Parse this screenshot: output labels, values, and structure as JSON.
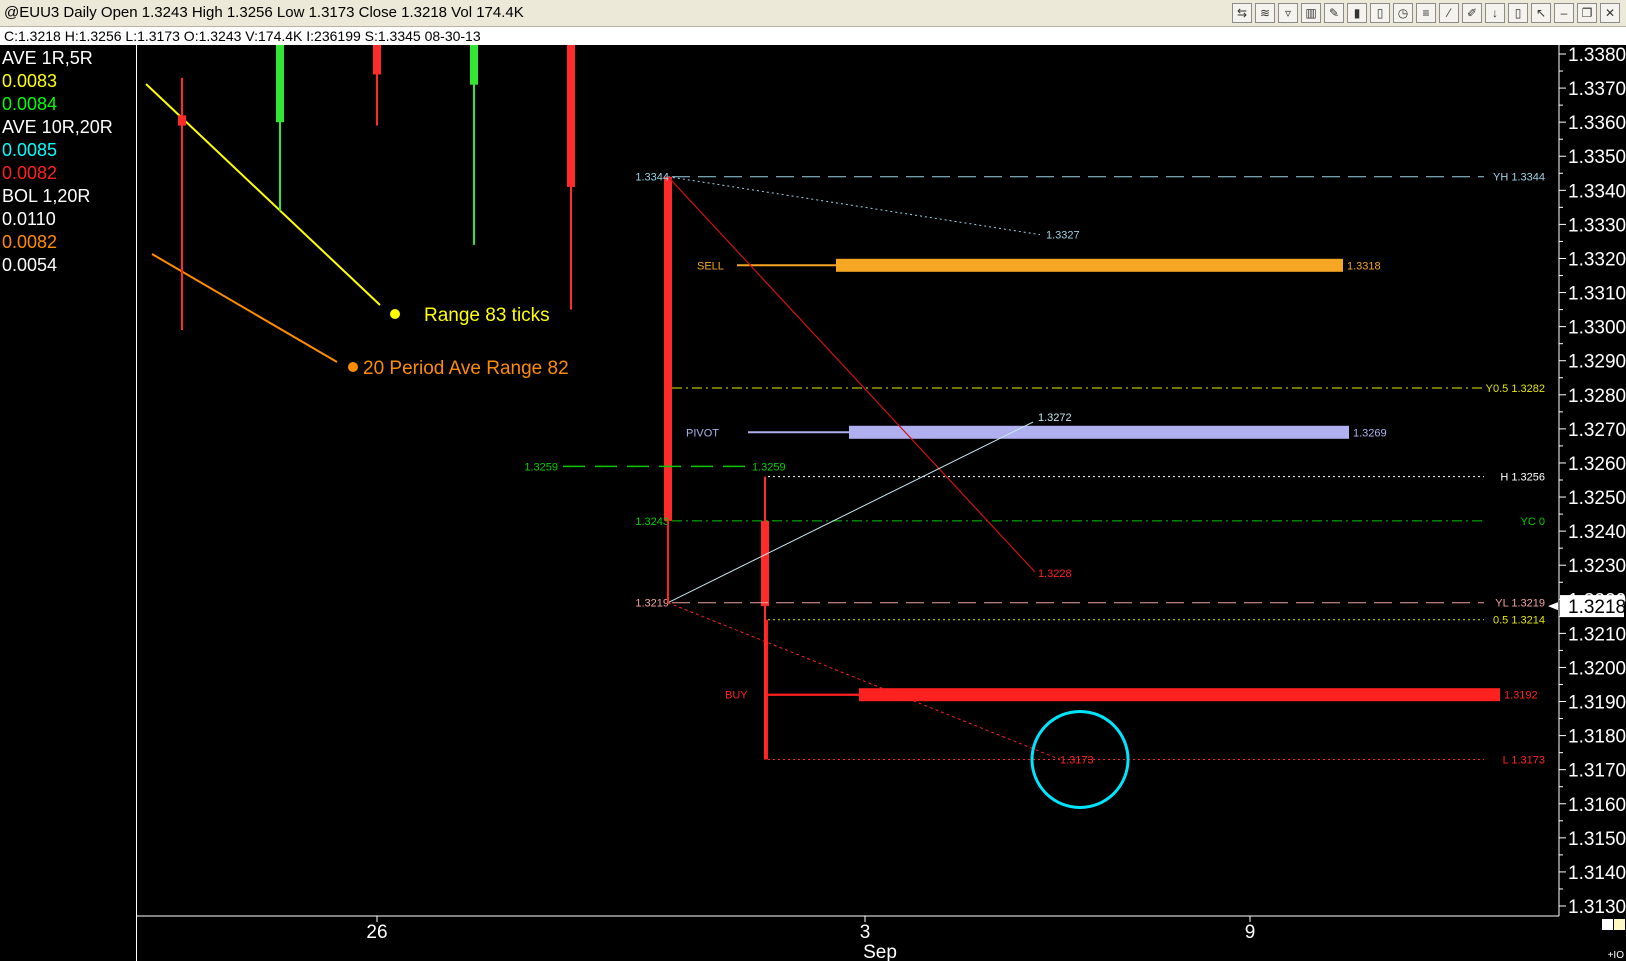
{
  "window": {
    "title": "@EUU3 Daily Open 1.3243 High 1.3256 Low 1.3173 Close 1.3218 Vol 174.4K",
    "info": "C:1.3218  H:1.3256  L:1.3173  O:1.3243  V:174.4K  I:236199  S:1.3345  08-30-13",
    "toolbar_icons": [
      "cursor-icon",
      "fibonacci-icon",
      "shapes-icon",
      "chart-icon",
      "pencil-icon",
      "bar-chart-icon",
      "candle-icon",
      "clock-icon",
      "checklist-icon",
      "trend-tool-icon",
      "pen-icon",
      "arrow-down-icon",
      "trash-icon",
      "pointer-icon",
      "minimize-icon",
      "restore-icon",
      "close-icon"
    ],
    "toolbar_glyphs": [
      "⇆",
      "≋",
      "▿",
      "▥",
      "✎",
      "▮",
      "▯",
      "◷",
      "≡",
      "⁄",
      "✐",
      "↓",
      "▯",
      "↖",
      "–",
      "❐",
      "✕"
    ]
  },
  "indicators": [
    {
      "text": "AVE  1R,5R",
      "color": "#ffffff"
    },
    {
      "text": "0.0083",
      "color": "#ffff00"
    },
    {
      "text": "0.0084",
      "color": "#00ff00"
    },
    {
      "text": "AVE  10R,20R",
      "color": "#ffffff"
    },
    {
      "text": "0.0085",
      "color": "#00ffff"
    },
    {
      "text": "0.0082",
      "color": "#ff2020"
    },
    {
      "text": "BOL  1,20R",
      "color": "#ffffff"
    },
    {
      "text": "0.0110",
      "color": "#ffffff"
    },
    {
      "text": "0.0082",
      "color": "#ff8c00"
    },
    {
      "text": "0.0054",
      "color": "#ffffff"
    }
  ],
  "chart_data": {
    "type": "candlestick",
    "y_range": [
      1.313,
      1.338
    ],
    "y_ticks": [
      "1.3380",
      "1.3370",
      "1.3360",
      "1.3350",
      "1.3340",
      "1.3330",
      "1.3320",
      "1.3310",
      "1.3300",
      "1.3290",
      "1.3280",
      "1.3270",
      "1.3260",
      "1.3250",
      "1.3240",
      "1.3230",
      "1.3220",
      "1.3210",
      "1.3200",
      "1.3190",
      "1.3180",
      "1.3170",
      "1.3160",
      "1.3150",
      "1.3140",
      "1.3130"
    ],
    "current_price": "1.3218",
    "x_ticks": [
      "26",
      "3",
      "9"
    ],
    "x_month": "Sep",
    "corner_label": "+IO",
    "candles": [
      {
        "slot": 1,
        "open": 1.3362,
        "high": 1.3373,
        "low": 1.3299,
        "close": 1.3359,
        "color": "red"
      },
      {
        "slot": 2,
        "open": 1.336,
        "high": 1.3401,
        "low": 1.3334,
        "close": 1.3392,
        "color": "green"
      },
      {
        "slot": 3,
        "open": 1.3388,
        "high": 1.3396,
        "low": 1.3359,
        "close": 1.3374,
        "color": "red"
      },
      {
        "slot": 4,
        "open": 1.3371,
        "high": 1.3409,
        "low": 1.3324,
        "close": 1.34,
        "color": "green"
      },
      {
        "slot": 5,
        "open": 1.3408,
        "high": 1.341,
        "low": 1.3305,
        "close": 1.3341,
        "color": "red"
      },
      {
        "slot": 6,
        "open": 1.3344,
        "high": 1.3344,
        "low": 1.3219,
        "close": 1.3243,
        "color": "red"
      },
      {
        "slot": 7,
        "open": 1.3243,
        "high": 1.3256,
        "low": 1.3173,
        "close": 1.3218,
        "color": "red"
      }
    ],
    "annotations": [
      {
        "text": "Range 83 ticks",
        "color": "#ffff00"
      },
      {
        "text": "20 Period Ave Range  82",
        "color": "#ff8c00"
      }
    ],
    "levels": [
      {
        "name": "YH",
        "label": "YH 1.3344",
        "price": 1.3344,
        "color": "#9ad3e6",
        "style": "longdash",
        "left_label": "1.3344"
      },
      {
        "name": "Y0.5",
        "label": "Y0.5 1.3282",
        "price": 1.3282,
        "color": "#e6e600",
        "style": "dashdot"
      },
      {
        "name": "H",
        "label": "H 1.3256",
        "price": 1.3256,
        "color": "#ffffff",
        "style": "dot"
      },
      {
        "name": "YC",
        "label": "YC 0",
        "price": 1.3243,
        "color": "#00cc00",
        "style": "dashdot",
        "left_label": "1.3243"
      },
      {
        "name": "YL",
        "label": "YL 1.3219",
        "price": 1.3219,
        "color": "#f0a0a0",
        "style": "longdash",
        "left_label": "1.3219"
      },
      {
        "name": "0.5",
        "label": "0.5 1.3214",
        "price": 1.3214,
        "color": "#e6e600",
        "style": "dot"
      },
      {
        "name": "L",
        "label": "L 1.3173",
        "price": 1.3173,
        "color": "#ff2020",
        "style": "dot"
      }
    ],
    "green_level": {
      "price": 1.3259,
      "label_left": "1.3259",
      "label_right": "1.3259"
    },
    "zones": [
      {
        "name": "SELL",
        "price": 1.3318,
        "label": "1.3318",
        "color": "#f5a623"
      },
      {
        "name": "PIVOT",
        "price": 1.3269,
        "label": "1.3269",
        "color": "#b0b0f0"
      },
      {
        "name": "BUY",
        "price": 1.3192,
        "label": "1.3192",
        "color": "#ff2020"
      }
    ],
    "projection_labels": {
      "white_dotted_end": "1.3327",
      "red_line_end": "1.3228",
      "cyan_line_end": "1.3272",
      "red_dotted_end": "1.3173"
    }
  }
}
